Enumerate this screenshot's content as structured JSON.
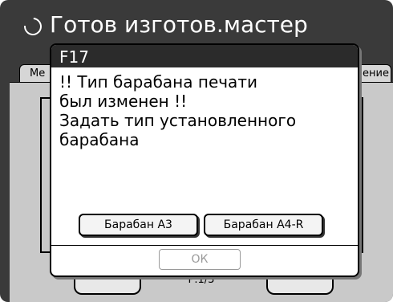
{
  "header": {
    "title": "Готов изготов.мастер",
    "status_icon": "busy-ring-icon"
  },
  "tabs": [
    {
      "label": "Ме"
    },
    {
      "label": "ение"
    }
  ],
  "footer": {
    "page_indicator": "Р.1/3"
  },
  "dialog": {
    "code": "F17",
    "message_lines": [
      "!! Тип барабана печати",
      "был изменен !!",
      "Задать тип установленного",
      "барабана"
    ],
    "buttons": {
      "drum_a3": "Барабан А3",
      "drum_a4r": "Барабан А4-R",
      "ok": "ОК"
    }
  }
}
